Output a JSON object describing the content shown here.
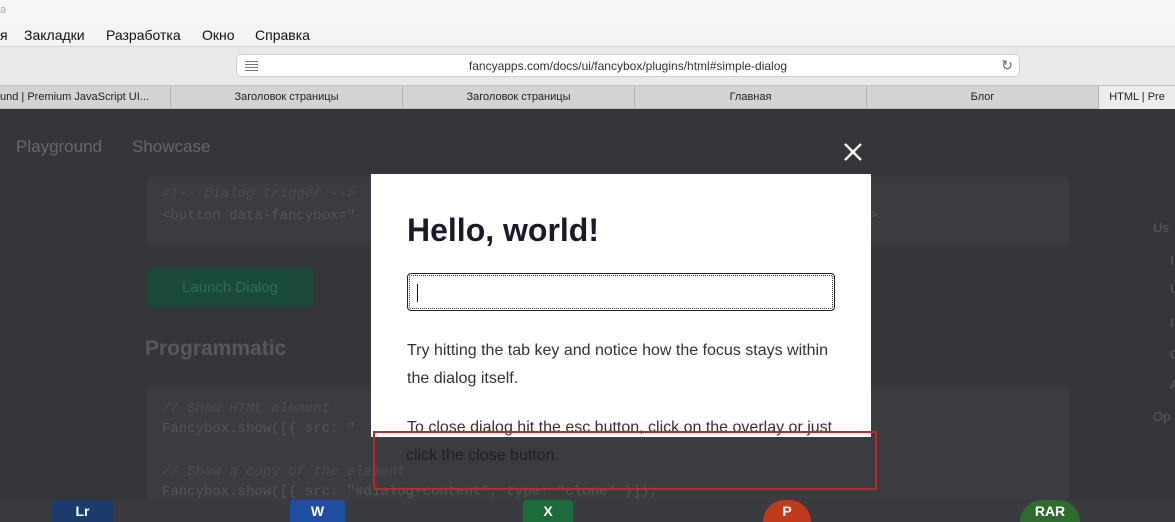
{
  "browser": {
    "title_fragment": "a",
    "menu": [
      "я",
      "Закладки",
      "Разработка",
      "Окно",
      "Справка"
    ],
    "url": "fancyapps.com/docs/ui/fancybox/plugins/html#simple-dialog",
    "tabs": [
      {
        "label": "und | Premium JavaScript UI..."
      },
      {
        "label": "Заголовок страницы"
      },
      {
        "label": "Заголовок страницы"
      },
      {
        "label": "Главная"
      },
      {
        "label": "Блог"
      },
      {
        "label": "HTML | Pre"
      }
    ],
    "active_tab_index": 5
  },
  "page": {
    "nav": [
      "Playground",
      "Showcase"
    ],
    "code_block_1": [
      "<!-- Dialog trigger -->",
      "<button data-fancybox=\""
    ],
    "code_block_1_tail": ">",
    "launch_button": "Launch Dialog",
    "section_heading": "Programmatic",
    "code_block_2": [
      "// Show HTML element",
      "Fancybox.show([{ src: \"",
      "// Show a copy of the element",
      "Fancybox.show([{ src: \"#dialog-content\", type: \"clone\" }]);"
    ],
    "side_nav": [
      "Us",
      "I",
      "U",
      "I",
      "C",
      "A",
      "Op"
    ]
  },
  "dialog": {
    "title": "Hello, world!",
    "input_value": "",
    "paragraph_1": "Try hitting the tab key and notice how the focus stays within the dialog itself.",
    "paragraph_2": "To close dialog hit the esc button, click on the overlay or just click the close button."
  },
  "dock": {
    "apps": [
      {
        "label": "Lr",
        "color": "#1a3b6b"
      },
      {
        "label": "W",
        "color": "#1f4fa3"
      },
      {
        "label": "X",
        "color": "#1d6b3a"
      },
      {
        "label": "P",
        "color": "#c23a1c"
      },
      {
        "label": "RAR",
        "color": "#2e6b2e"
      }
    ]
  },
  "colors": {
    "highlight": "#c4242b",
    "overlay": "#35363a",
    "dialog_bg": "#ffffff"
  }
}
